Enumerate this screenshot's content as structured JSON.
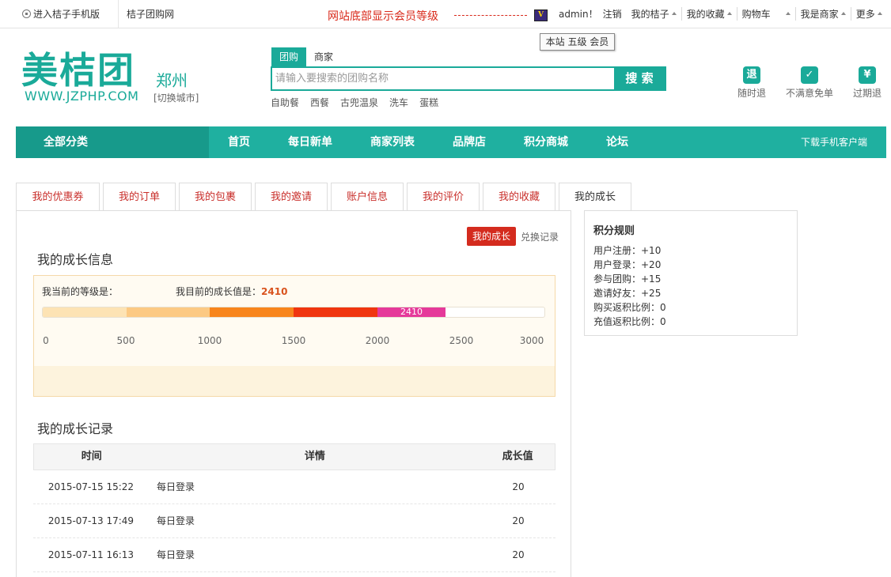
{
  "topbar": {
    "mobile_label": "进入桔子手机版",
    "site_label": "桔子团购网",
    "annotation": "网站底部显示会员等级",
    "vip_icon_text": "V",
    "user": "admin！",
    "logout": "注销",
    "my_juzi": "我的桔子",
    "my_fav": "我的收藏",
    "cart": "购物车",
    "merchant": "我是商家",
    "more": "更多",
    "level_tooltip": "本站 五级 会员"
  },
  "header": {
    "logo_cn": "美桔团",
    "logo_url": "WWW.JZPHP.COM",
    "city": "郑州",
    "city_switch": "[切换城市]",
    "search_tabs": [
      "团购",
      "商家"
    ],
    "search_placeholder": "请输入要搜索的团购名称",
    "search_button": "搜 索",
    "hot_words": [
      "自助餐",
      "西餐",
      "古兜温泉",
      "洗车",
      "蛋糕"
    ],
    "badges": [
      {
        "icon": "退",
        "label": "随时退"
      },
      {
        "icon": "✓",
        "label": "不满意免单"
      },
      {
        "icon": "¥",
        "label": "过期退"
      }
    ]
  },
  "nav": {
    "all": "全部分类",
    "links": [
      "首页",
      "每日新单",
      "商家列表",
      "品牌店",
      "积分商城",
      "论坛"
    ],
    "app": "下载手机客户端"
  },
  "account_tabs": [
    "我的优惠券",
    "我的订单",
    "我的包裹",
    "我的邀请",
    "账户信息",
    "我的评价",
    "我的收藏",
    "我的成长"
  ],
  "growth": {
    "sub_active": "我的成长",
    "sub_link": "兑换记录",
    "info_title": "我的成长信息",
    "level_label": "我当前的等级是：",
    "value_label": "我目前的成长值是：",
    "value": "2410",
    "bar_value_text": "2410",
    "current_value": 2410,
    "max_value": 3000,
    "ticks": [
      "0",
      "500",
      "1000",
      "1500",
      "2000",
      "2500",
      "3000"
    ],
    "segment_colors": [
      "#fde3b4",
      "#fcc983",
      "#f8851c",
      "#f0350f",
      "#e5399a"
    ],
    "record_title": "我的成长记录",
    "columns": {
      "time": "时间",
      "detail": "详情",
      "growth": "成长值"
    },
    "records": [
      {
        "time": "2015-07-15 15:22",
        "detail": "每日登录",
        "growth": "20"
      },
      {
        "time": "2015-07-13 17:49",
        "detail": "每日登录",
        "growth": "20"
      },
      {
        "time": "2015-07-11 16:13",
        "detail": "每日登录",
        "growth": "20"
      }
    ]
  },
  "rules": {
    "title": "积分规则",
    "lines": [
      "用户注册：+10",
      "用户登录：+20",
      "参与团购：+15",
      "邀请好友：+25",
      "购买返积比例：0",
      "充值返积比例：0"
    ]
  }
}
